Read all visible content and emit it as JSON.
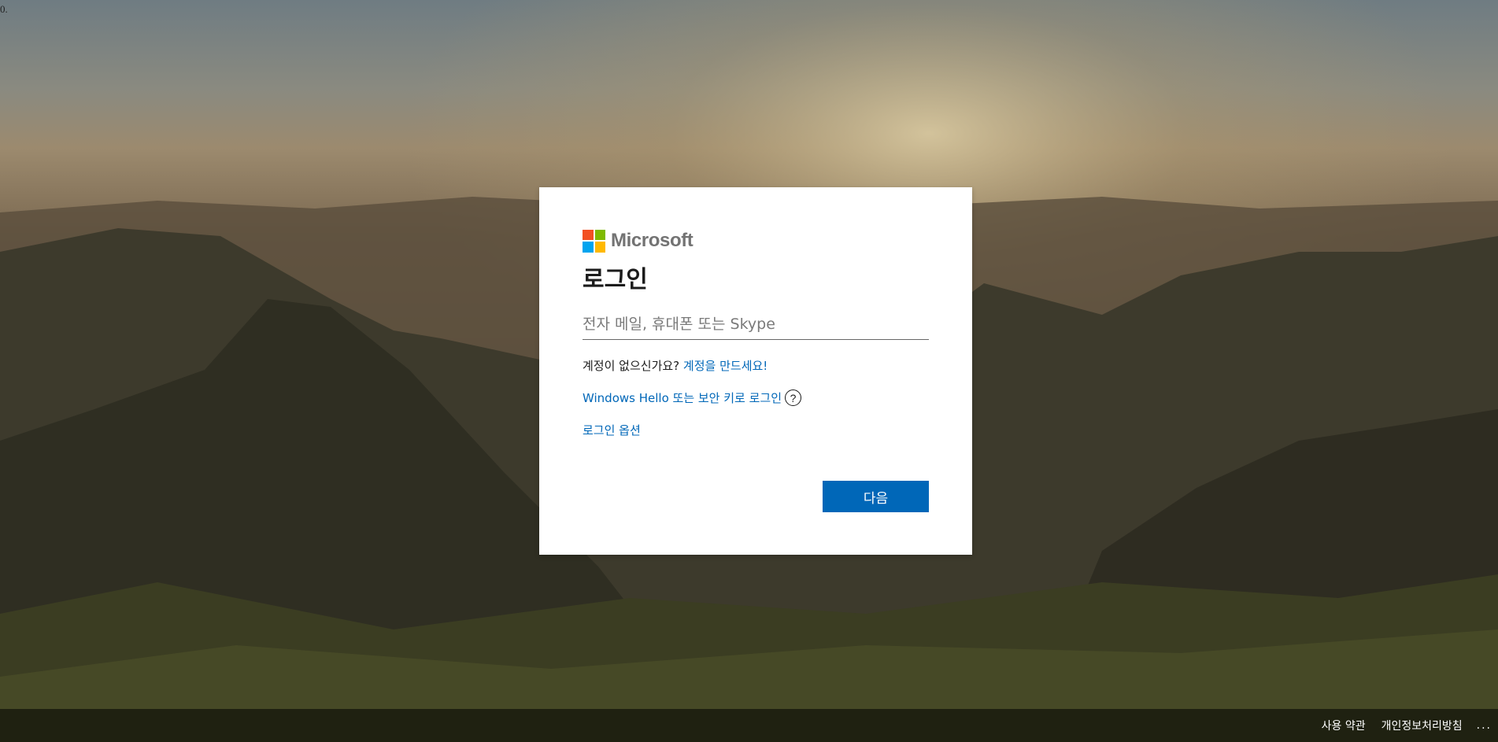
{
  "corner_text": "0.",
  "brand": {
    "name": "Microsoft"
  },
  "signin": {
    "title": "로그인",
    "email_placeholder": "전자 메일, 휴대폰 또는 Skype",
    "email_value": "",
    "no_account_text": "계정이 없으신가요?",
    "create_account_link": "계정을 만드세요!",
    "windows_hello_link": "Windows Hello 또는 보안 키로 로그인",
    "help_icon_glyph": "?",
    "signin_options_link": "로그인 옵션",
    "next_button": "다음"
  },
  "footer": {
    "terms": "사용 약관",
    "privacy": "개인정보처리방침",
    "more": "..."
  },
  "colors": {
    "accent": "#0067b8",
    "logo_red": "#f25022",
    "logo_green": "#7fba00",
    "logo_blue": "#00a4ef",
    "logo_yellow": "#ffb900"
  },
  "icons": [
    "microsoft-logo-icon",
    "help-icon"
  ]
}
